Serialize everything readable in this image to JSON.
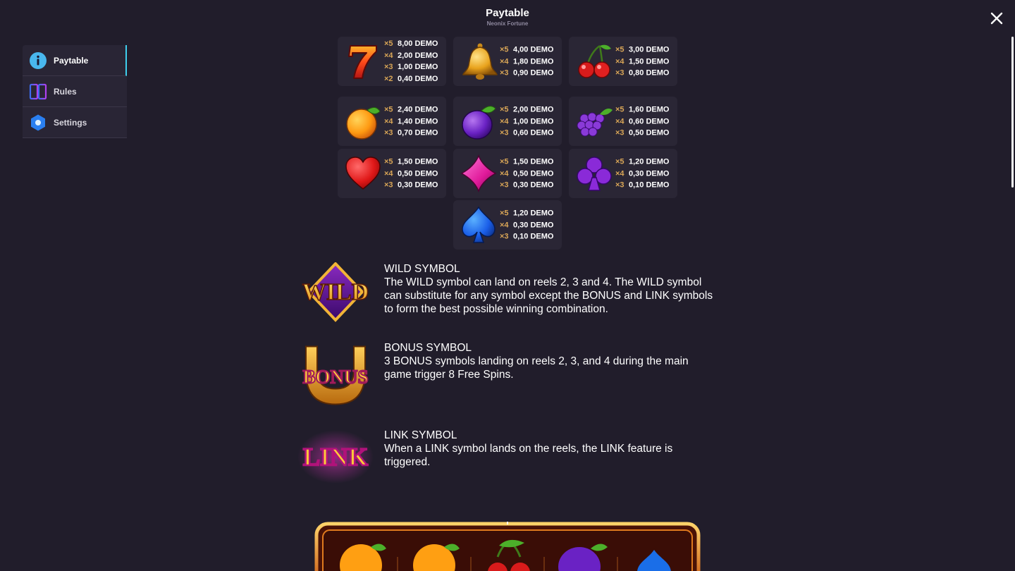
{
  "header": {
    "title": "Paytable",
    "subtitle": "Neonix Fortune"
  },
  "sidebar": {
    "items": [
      {
        "label": "Paytable",
        "icon": "info-icon",
        "active": true
      },
      {
        "label": "Rules",
        "icon": "book-icon",
        "active": false
      },
      {
        "label": "Settings",
        "icon": "hexagon-settings-icon",
        "active": false
      }
    ]
  },
  "paytable": [
    {
      "symbol": "seven",
      "payouts": [
        {
          "mult": "×5",
          "amount": "8,00 DEMO"
        },
        {
          "mult": "×4",
          "amount": "2,00 DEMO"
        },
        {
          "mult": "×3",
          "amount": "1,00 DEMO"
        },
        {
          "mult": "×2",
          "amount": "0,40 DEMO"
        }
      ]
    },
    {
      "symbol": "bell",
      "payouts": [
        {
          "mult": "×5",
          "amount": "4,00 DEMO"
        },
        {
          "mult": "×4",
          "amount": "1,80 DEMO"
        },
        {
          "mult": "×3",
          "amount": "0,90 DEMO"
        }
      ]
    },
    {
      "symbol": "cherry",
      "payouts": [
        {
          "mult": "×5",
          "amount": "3,00 DEMO"
        },
        {
          "mult": "×4",
          "amount": "1,50 DEMO"
        },
        {
          "mult": "×3",
          "amount": "0,80 DEMO"
        }
      ]
    },
    {
      "symbol": "orange",
      "payouts": [
        {
          "mult": "×5",
          "amount": "2,40 DEMO"
        },
        {
          "mult": "×4",
          "amount": "1,40 DEMO"
        },
        {
          "mult": "×3",
          "amount": "0,70 DEMO"
        }
      ]
    },
    {
      "symbol": "plum",
      "payouts": [
        {
          "mult": "×5",
          "amount": "2,00 DEMO"
        },
        {
          "mult": "×4",
          "amount": "1,00 DEMO"
        },
        {
          "mult": "×3",
          "amount": "0,60 DEMO"
        }
      ]
    },
    {
      "symbol": "grapes",
      "payouts": [
        {
          "mult": "×5",
          "amount": "1,60 DEMO"
        },
        {
          "mult": "×4",
          "amount": "0,60 DEMO"
        },
        {
          "mult": "×3",
          "amount": "0,50 DEMO"
        }
      ]
    },
    {
      "symbol": "heart",
      "payouts": [
        {
          "mult": "×5",
          "amount": "1,50 DEMO"
        },
        {
          "mult": "×4",
          "amount": "0,50 DEMO"
        },
        {
          "mult": "×3",
          "amount": "0,30 DEMO"
        }
      ]
    },
    {
      "symbol": "diamond",
      "payouts": [
        {
          "mult": "×5",
          "amount": "1,50 DEMO"
        },
        {
          "mult": "×4",
          "amount": "0,50 DEMO"
        },
        {
          "mult": "×3",
          "amount": "0,30 DEMO"
        }
      ]
    },
    {
      "symbol": "club",
      "payouts": [
        {
          "mult": "×5",
          "amount": "1,20 DEMO"
        },
        {
          "mult": "×4",
          "amount": "0,30 DEMO"
        },
        {
          "mult": "×3",
          "amount": "0,10 DEMO"
        }
      ]
    },
    {
      "symbol": "spade",
      "payouts": [
        {
          "mult": "×5",
          "amount": "1,20 DEMO"
        },
        {
          "mult": "×4",
          "amount": "0,30 DEMO"
        },
        {
          "mult": "×3",
          "amount": "0,10 DEMO"
        }
      ]
    }
  ],
  "specials": {
    "wild": {
      "logo_text": "WILD",
      "heading": "WILD SYMBOL",
      "description": "The WILD symbol can land on reels 2, 3 and 4. The WILD symbol can substitute for any symbol except the BONUS and LINK symbols to form the best possible winning combination."
    },
    "bonus": {
      "logo_text": "BONUS",
      "heading": "BONUS SYMBOL",
      "description": "3 BONUS symbols landing on reels 2, 3, and 4 during the main game trigger 8 Free Spins."
    },
    "link": {
      "logo_text": "LINK",
      "heading": "LINK SYMBOL",
      "description": "When a LINK symbol lands on the reels, the LINK feature is triggered."
    }
  },
  "reel_preview": {
    "symbols": [
      "orange",
      "orange",
      "cherry",
      "plum",
      "spade"
    ]
  },
  "colors": {
    "background": "#211d2b",
    "card": "#2a2635",
    "multiplier": "#d9a657",
    "active_accent": "#3fd0ee"
  }
}
